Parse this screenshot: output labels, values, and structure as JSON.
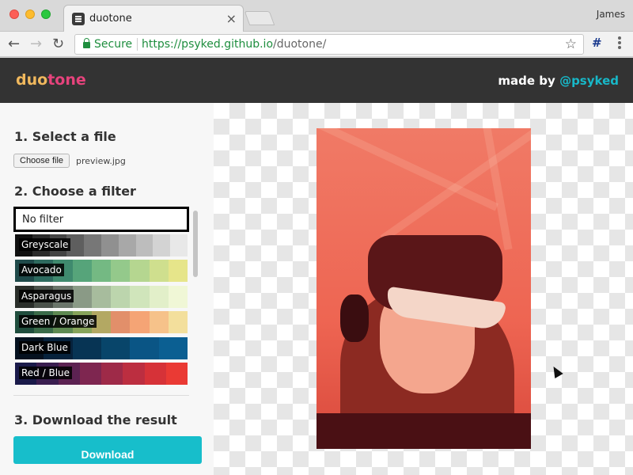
{
  "browser": {
    "tab_title": "duotone",
    "profile_name": "James",
    "security_label": "Secure",
    "url_origin": "https://psyked.github.io",
    "url_path": "/duotone/",
    "extension_label": "#"
  },
  "site": {
    "logo_part1": "duo",
    "logo_part2": "tone",
    "made_by_prefix": "made by",
    "made_by_link": "@psyked"
  },
  "steps": {
    "select_file": "1. Select a file",
    "choose_filter": "2. Choose a filter",
    "download_result": "3. Download the result"
  },
  "file": {
    "button_label": "Choose file",
    "file_name": "preview.jpg"
  },
  "filters": [
    {
      "name": "No filter",
      "selected": true,
      "colors": []
    },
    {
      "name": "Greyscale",
      "selected": false,
      "colors": [
        "#101010",
        "#2b2b2b",
        "#444444",
        "#5e5e5e",
        "#777777",
        "#909090",
        "#a8a8a8",
        "#bdbdbd",
        "#d3d3d3",
        "#e8e8e8"
      ]
    },
    {
      "name": "Avocado",
      "selected": false,
      "colors": [
        "#1f4a4a",
        "#2e6b5f",
        "#3f8a6e",
        "#56a47a",
        "#74b983",
        "#94c98b",
        "#b5d690",
        "#cfdf8e",
        "#e6e58a"
      ]
    },
    {
      "name": "Asparagus",
      "selected": false,
      "colors": [
        "#2a2e2a",
        "#4a514a",
        "#6a756a",
        "#8a9a86",
        "#a7bc9d",
        "#bcd5ad",
        "#d0e5bb",
        "#e2efc9",
        "#f0f7d6"
      ]
    },
    {
      "name": "Green / Orange",
      "selected": false,
      "colors": [
        "#1f4d3d",
        "#3a6b49",
        "#5e8a52",
        "#87a45a",
        "#b3a863",
        "#e28f6a",
        "#f5a475",
        "#f6c28a",
        "#f3df9c"
      ]
    },
    {
      "name": "Dark Blue",
      "selected": false,
      "colors": [
        "#05111f",
        "#06223c",
        "#073454",
        "#08456a",
        "#0a5585",
        "#0b5f92"
      ]
    },
    {
      "name": "Red / Blue",
      "selected": false,
      "colors": [
        "#1a1a4a",
        "#3a1e50",
        "#5c2252",
        "#7e2650",
        "#9e2a48",
        "#bc2e40",
        "#d63238",
        "#ea3a34"
      ]
    }
  ],
  "download_label": "Download"
}
